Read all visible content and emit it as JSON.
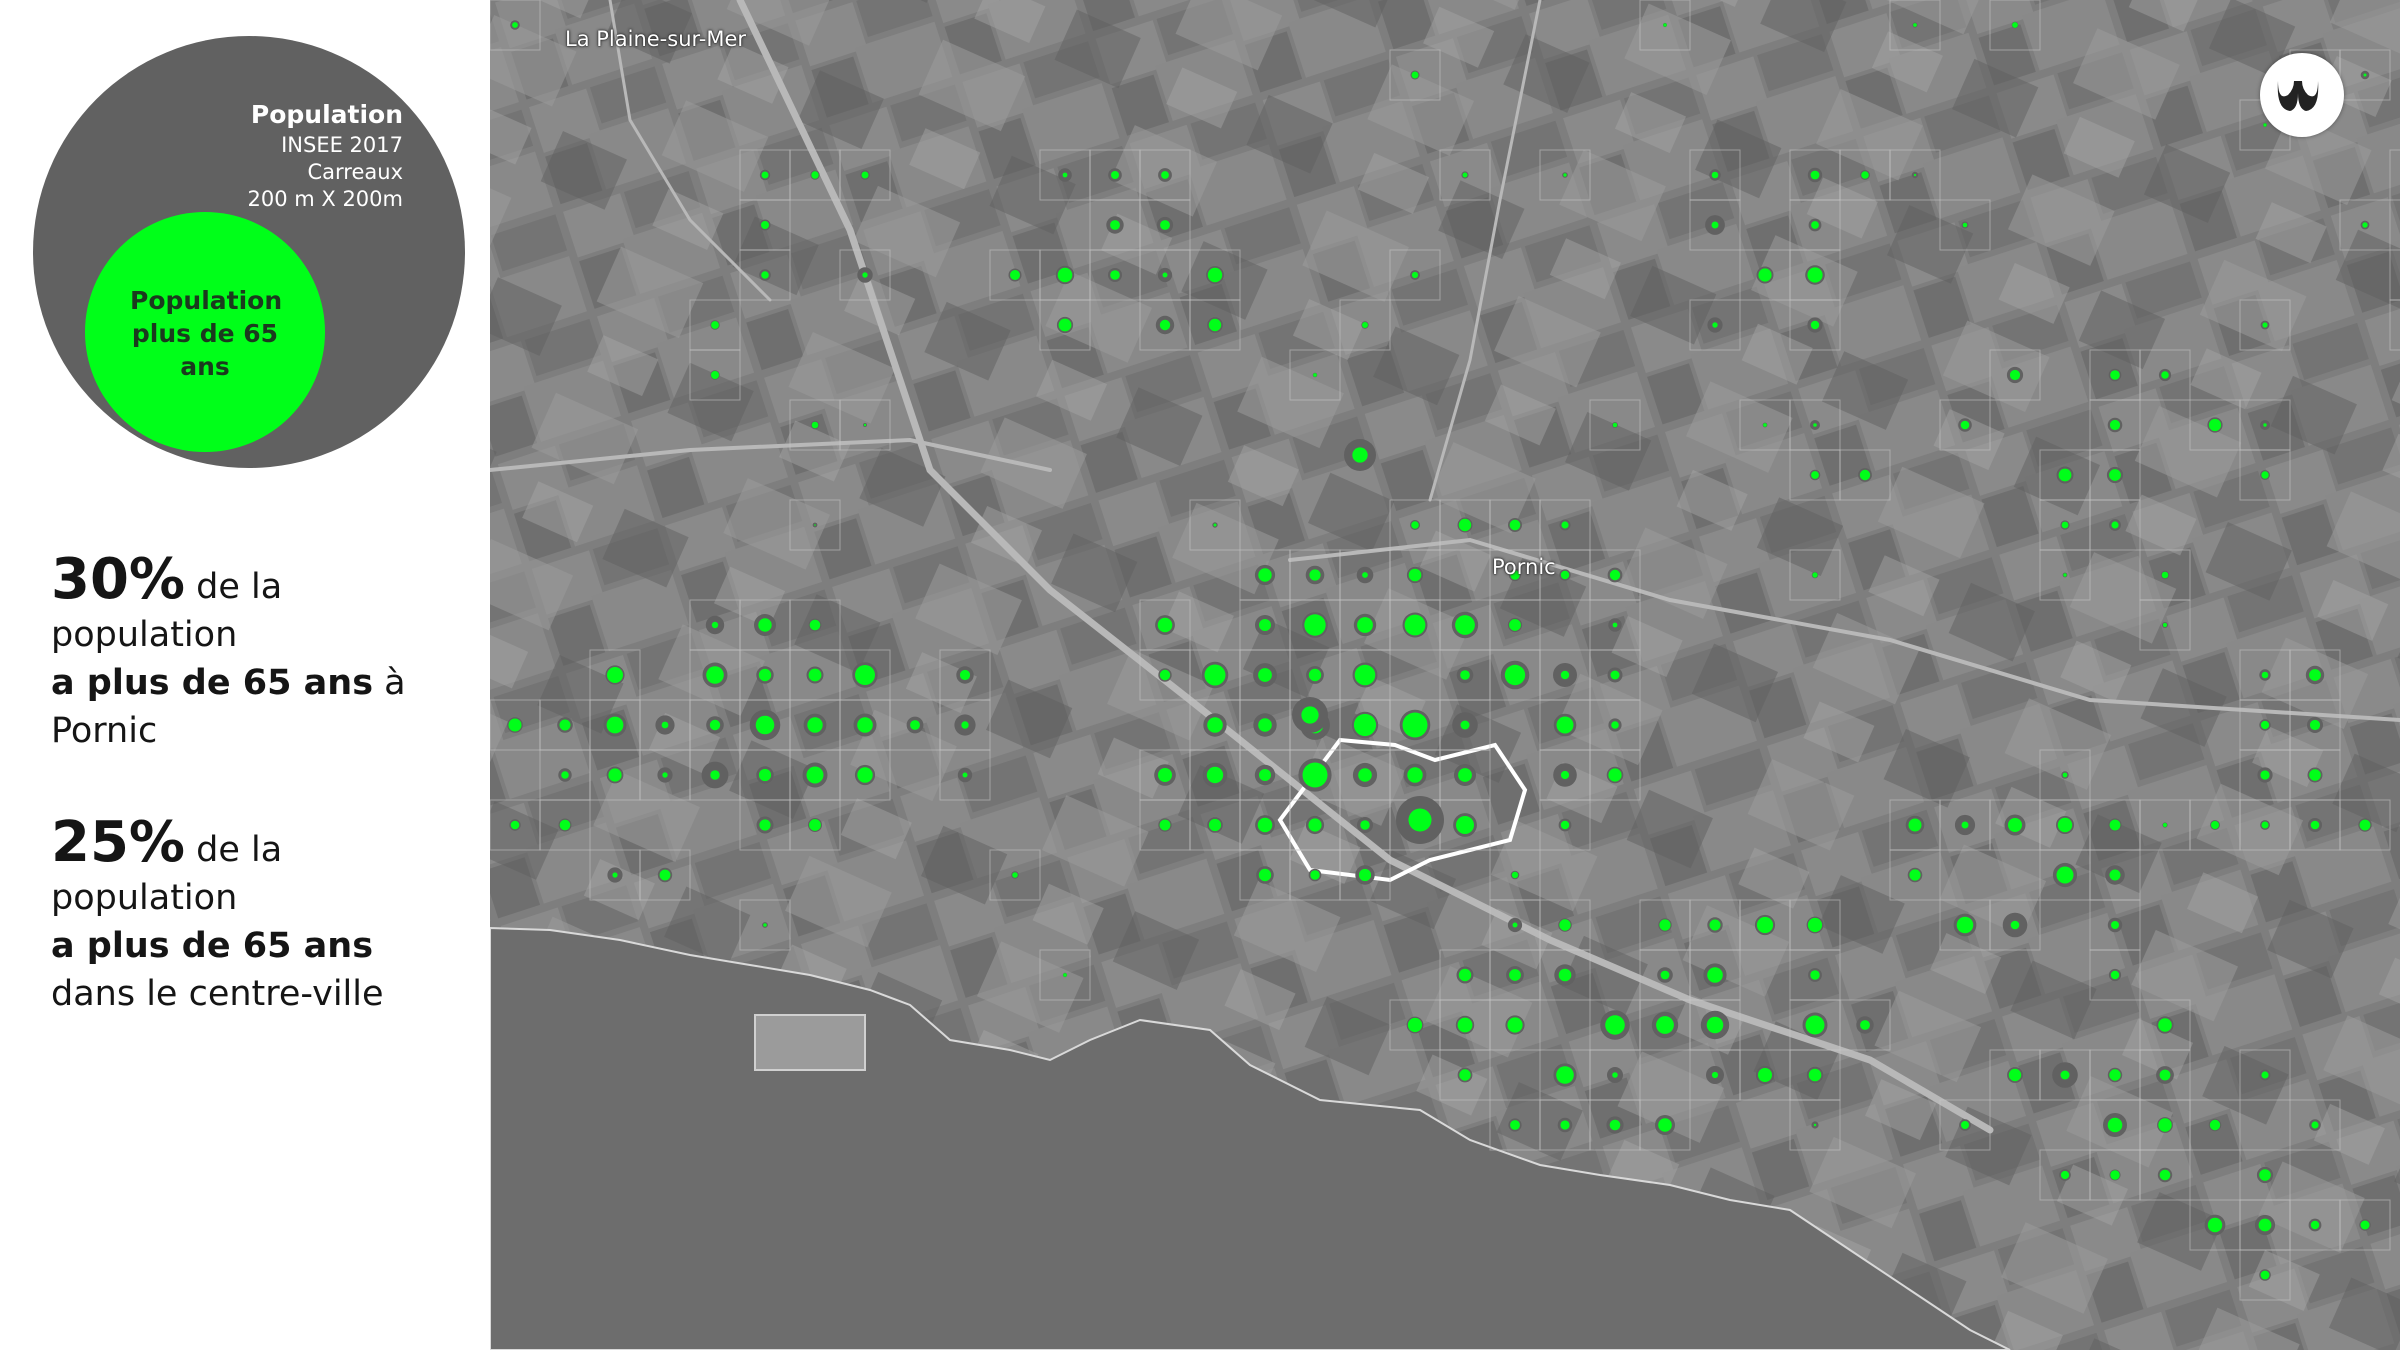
{
  "legend": {
    "outer_title": "Population",
    "outer_source": "INSEE 2017",
    "outer_grid": "Carreaux",
    "outer_size": "200 m X 200m",
    "inner_label": "Population plus de 65 ans"
  },
  "stats": [
    {
      "percent": "30%",
      "rest_line1": " de la",
      "line2": "population",
      "bold_phrase": "a plus de 65 ans",
      "after_bold": " à",
      "line4": "Pornic"
    },
    {
      "percent": "25%",
      "rest_line1": " de la",
      "line2": "population",
      "bold_phrase": "a plus de 65 ans",
      "after_bold": "",
      "line4": "dans le centre-ville"
    }
  ],
  "map": {
    "places": {
      "plaine": "La Plaine-sur-Mer",
      "pornic": "Pornic"
    },
    "logo_icon": "brand-logo-icon",
    "colors": {
      "total_population": "#616161",
      "population_65_plus": "#00ff19",
      "sea": "#6f6f6f",
      "land": "#868686"
    }
  }
}
